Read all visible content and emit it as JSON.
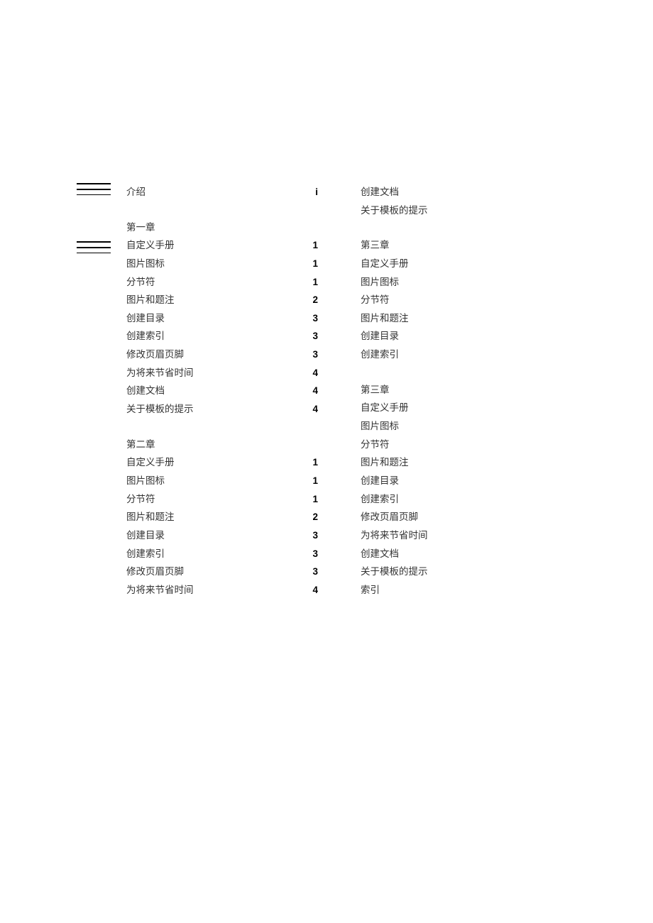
{
  "intro": {
    "label": "介绍",
    "page": "i"
  },
  "left_groups": [
    {
      "heading": "第一章",
      "items": [
        {
          "label": "自定义手册",
          "page": "1"
        },
        {
          "label": "图片图标",
          "page": "1"
        },
        {
          "label": "分节符",
          "page": "1"
        },
        {
          "label": "图片和题注",
          "page": "2"
        },
        {
          "label": "创建目录",
          "page": "3"
        },
        {
          "label": "创建索引",
          "page": "3"
        },
        {
          "label": "修改页眉页脚",
          "page": "3"
        },
        {
          "label": "为将来节省时间",
          "page": "4"
        },
        {
          "label": "创建文档",
          "page": "4"
        },
        {
          "label": "关于模板的提示",
          "page": "4"
        }
      ]
    },
    {
      "heading": "第二章",
      "items": [
        {
          "label": "自定义手册",
          "page": "1"
        },
        {
          "label": "图片图标",
          "page": "1"
        },
        {
          "label": "分节符",
          "page": "1"
        },
        {
          "label": "图片和题注",
          "page": "2"
        },
        {
          "label": "创建目录",
          "page": "3"
        },
        {
          "label": "创建索引",
          "page": "3"
        },
        {
          "label": "修改页眉页脚",
          "page": "3"
        },
        {
          "label": "为将来节省时间",
          "page": "4"
        }
      ]
    }
  ],
  "right_groups": [
    {
      "heading": null,
      "items": [
        {
          "label": "创建文档"
        },
        {
          "label": "关于模板的提示"
        }
      ]
    },
    {
      "heading": "第三章",
      "items": [
        {
          "label": "自定义手册"
        },
        {
          "label": "图片图标"
        },
        {
          "label": "分节符"
        },
        {
          "label": "图片和题注"
        },
        {
          "label": "创建目录"
        },
        {
          "label": "创建索引"
        }
      ]
    },
    {
      "heading": "第三章",
      "items": [
        {
          "label": "自定义手册"
        },
        {
          "label": "图片图标"
        },
        {
          "label": "分节符"
        },
        {
          "label": "图片和题注"
        },
        {
          "label": "创建目录"
        },
        {
          "label": "创建索引"
        },
        {
          "label": "修改页眉页脚"
        },
        {
          "label": "为将来节省时间"
        },
        {
          "label": "创建文档"
        },
        {
          "label": "关于模板的提示"
        },
        {
          "label": "索引"
        }
      ]
    }
  ]
}
